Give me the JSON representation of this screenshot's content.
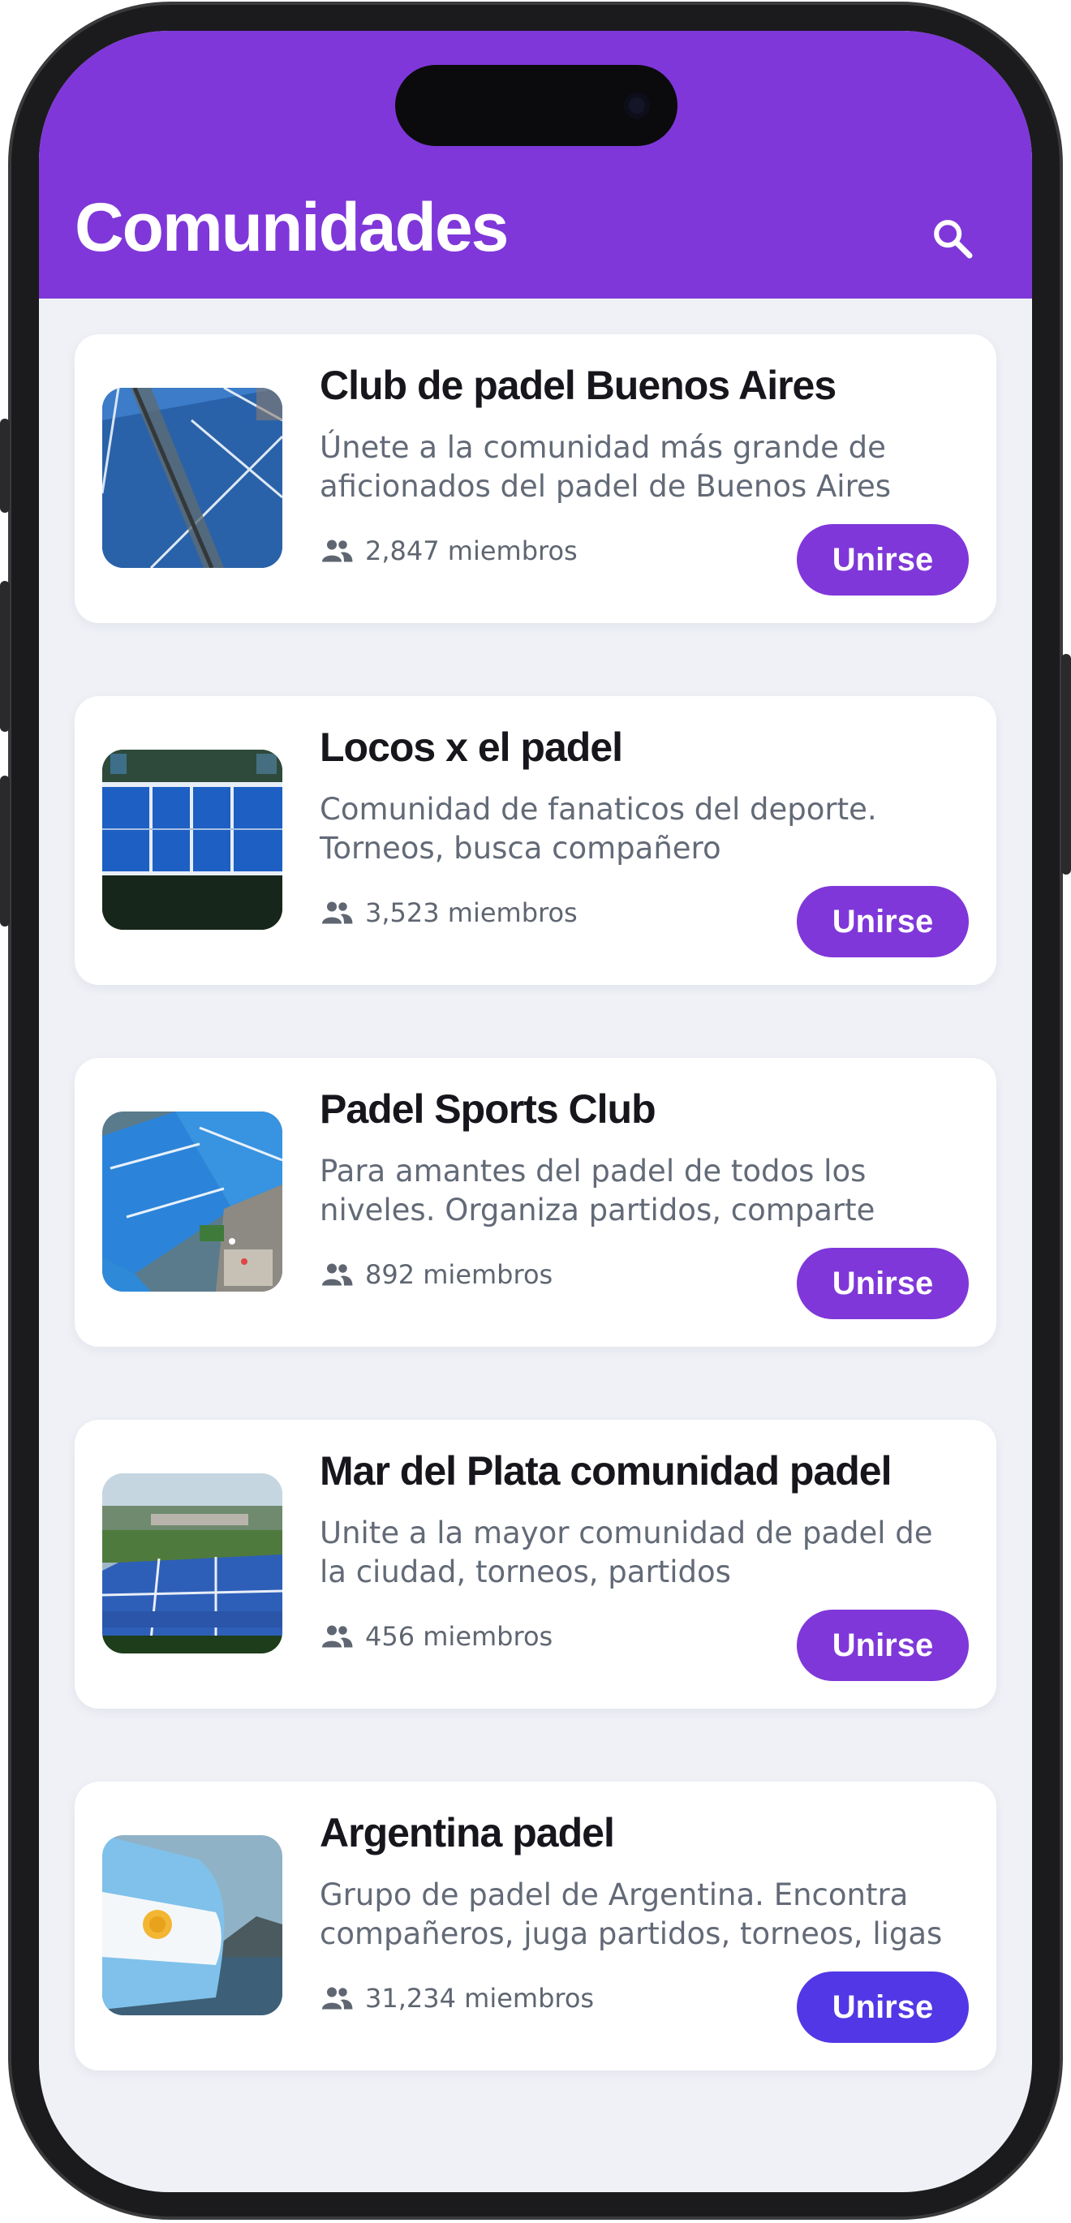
{
  "header": {
    "title": "Comunidades",
    "search_icon": "search-icon"
  },
  "colors": {
    "primary": "#7f37d9",
    "primary_alt": "#5237e6",
    "background": "#eff1f6",
    "card": "#ffffff",
    "title_text": "#16161c",
    "secondary_text": "#636a77"
  },
  "communities": [
    {
      "name": "Club de padel Buenos Aires",
      "description": "Únete a la comunidad más grande de aficionados del padel de Buenos Aires",
      "members": "2,847 miembros",
      "button": "Unirse",
      "image": "blue-padel-court-photo"
    },
    {
      "name": "Locos x el padel",
      "description": "Comunidad de fanaticos del deporte. Torneos, busca compañero",
      "members": "3,523 miembros",
      "button": "Unirse",
      "image": "aerial-padel-courts-photo"
    },
    {
      "name": "Padel Sports Club",
      "description": "Para amantes del padel de todos los niveles. Organiza partidos, comparte",
      "members": "892 miembros",
      "button": "Unirse",
      "image": "aerial-sports-club-photo"
    },
    {
      "name": "Mar del Plata comunidad padel",
      "description": "Unite a la mayor comunidad de padel de la ciudad, torneos, partidos",
      "members": "456 miembros",
      "button": "Unirse",
      "image": "outdoor-padel-courts-photo"
    },
    {
      "name": "Argentina padel",
      "description": "Grupo de padel de Argentina. Encontra compañeros, juga partidos, torneos, ligas",
      "members": "31,234 miembros",
      "button": "Unirse",
      "image": "argentina-flag-photo"
    }
  ]
}
